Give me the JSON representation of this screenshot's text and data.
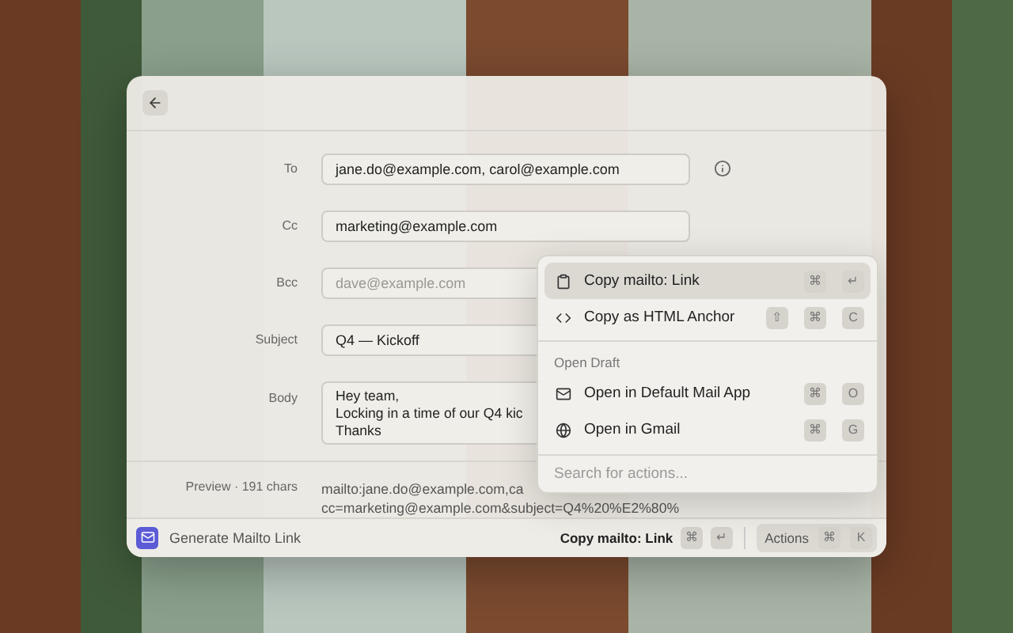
{
  "fields": [
    {
      "label": "To",
      "kind": "input",
      "value": "jane.do@example.com, carol@example.com",
      "info": true
    },
    {
      "label": "Cc",
      "kind": "input",
      "value": "marketing@example.com",
      "info": false
    },
    {
      "label": "Bcc",
      "kind": "input",
      "placeholder": "dave@example.com",
      "info": false
    },
    {
      "label": "Subject",
      "kind": "input",
      "value": "Q4 — Kickoff",
      "info": false
    },
    {
      "label": "Body",
      "kind": "textarea",
      "lines": [
        "Hey team,",
        "Locking in a time of our Q4 kic",
        "Thanks"
      ],
      "info": false
    }
  ],
  "preview": {
    "label": "Preview · 191 chars",
    "lines": [
      "mailto:jane.do@example.com,ca",
      "cc=marketing@example.com&subject=Q4%20%E2%80%"
    ]
  },
  "actions_menu": {
    "items": [
      {
        "kind": "action",
        "label": "Copy mailto: Link",
        "keys": [
          "⌘",
          "↵"
        ],
        "selected": true
      },
      {
        "kind": "action",
        "label": "Copy as HTML Anchor",
        "keys": [
          "⇧",
          "⌘",
          "C"
        ],
        "selected": false
      },
      {
        "kind": "section",
        "label": "Open Draft"
      },
      {
        "kind": "action",
        "label": "Open in Default Mail App",
        "keys": [
          "⌘",
          "O"
        ],
        "selected": false
      },
      {
        "kind": "action",
        "label": "Open in Gmail",
        "keys": [
          "⌘",
          "G"
        ],
        "selected": false
      }
    ],
    "search": {
      "placeholder": "Search for actions..."
    }
  },
  "footer": {
    "title": "Generate Mailto Link",
    "primary_action": {
      "label": "Copy mailto: Link",
      "keys": [
        "⌘",
        "↵"
      ]
    },
    "actions_button": {
      "label": "Actions",
      "keys": [
        "⌘",
        "K"
      ]
    }
  }
}
